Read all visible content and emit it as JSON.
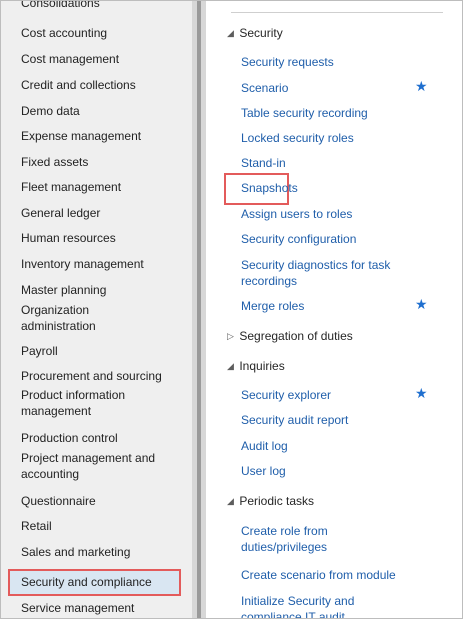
{
  "modules": [
    "Consolidations",
    "Cost accounting",
    "Cost management",
    "Credit and collections",
    "Demo data",
    "Expense management",
    "Fixed assets",
    "Fleet management",
    "General ledger",
    "Human resources",
    "Inventory management",
    "Master planning",
    "Organization administration",
    "Payroll",
    "Procurement and sourcing",
    "Product information management",
    "Production control",
    "Project management and accounting",
    "Questionnaire",
    "Retail",
    "Sales and marketing",
    "Security and compliance",
    "Service management"
  ],
  "selected_module": "Security and compliance",
  "sections": {
    "security": {
      "label": "Security",
      "items": [
        "Security requests",
        "Scenario",
        "Table security recording",
        "Locked security roles",
        "Stand-in",
        "Snapshots",
        "Assign users to roles",
        "Security configuration",
        "Security diagnostics for task recordings",
        "Merge roles"
      ]
    },
    "segregation": {
      "label": "Segregation of duties"
    },
    "inquiries": {
      "label": "Inquiries",
      "items": [
        "Security explorer",
        "Security audit report",
        "Audit log",
        "User log"
      ]
    },
    "periodic": {
      "label": "Periodic tasks",
      "items": [
        "Create role from duties/privileges",
        "Create scenario from module",
        "Initialize Security and compliance IT audit"
      ]
    }
  },
  "icons": {
    "favorite": "star-icon",
    "expanded": "expanded-arrow-icon",
    "collapsed": "collapsed-arrow-icon"
  },
  "colors": {
    "link": "#1f5eaa",
    "star": "#1f6fcf",
    "highlight": "#e35b5b",
    "left_background": "#efefef"
  }
}
